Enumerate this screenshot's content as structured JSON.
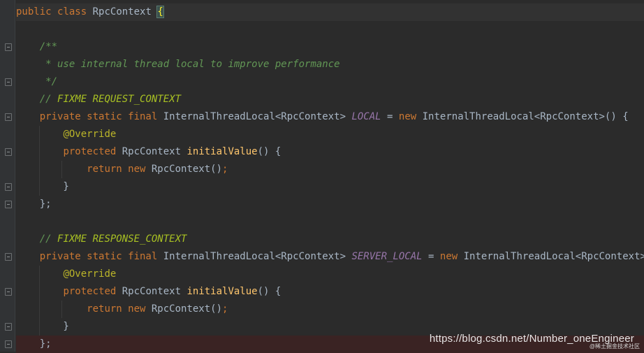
{
  "editor": {
    "theme": "Darcula",
    "colors": {
      "background": "#2b2b2b",
      "keyword": "#cc7832",
      "comment": "#629755",
      "todo": "#a8c023",
      "annotation": "#bbb529",
      "method": "#ffc66d",
      "field": "#9876aa",
      "text": "#a9b7c6"
    },
    "lines": [
      [
        {
          "k": "public"
        },
        {
          "p": " "
        },
        {
          "k": "class"
        },
        {
          "p": " RpcContext "
        },
        {
          "b": "{"
        }
      ],
      [],
      [
        {
          "p": "    "
        },
        {
          "c": "/**"
        }
      ],
      [
        {
          "p": "    "
        },
        {
          "c": " * use internal thread local to improve performance"
        }
      ],
      [
        {
          "p": "    "
        },
        {
          "c": " */"
        }
      ],
      [
        {
          "p": "    "
        },
        {
          "c": "// "
        },
        {
          "t": "FIXME REQUEST_CONTEXT"
        }
      ],
      [
        {
          "p": "    "
        },
        {
          "k": "private static final"
        },
        {
          "p": " InternalThreadLocal<RpcContext> "
        },
        {
          "f": "LOCAL"
        },
        {
          "p": " = "
        },
        {
          "k": "new"
        },
        {
          "p": " InternalThreadLocal<RpcContext>() {"
        }
      ],
      [
        {
          "p": "        "
        },
        {
          "a": "@Override"
        }
      ],
      [
        {
          "p": "        "
        },
        {
          "k": "protected"
        },
        {
          "p": " RpcContext "
        },
        {
          "m": "initialValue"
        },
        {
          "p": "() {"
        }
      ],
      [
        {
          "p": "            "
        },
        {
          "k": "return new"
        },
        {
          "p": " RpcContext()"
        },
        {
          "k": ";"
        }
      ],
      [
        {
          "p": "        }"
        }
      ],
      [
        {
          "p": "    };"
        }
      ],
      [],
      [
        {
          "p": "    "
        },
        {
          "c": "// "
        },
        {
          "t": "FIXME RESPONSE_CONTEXT"
        }
      ],
      [
        {
          "p": "    "
        },
        {
          "k": "private static final"
        },
        {
          "p": " InternalThreadLocal<RpcContext> "
        },
        {
          "f": "SERVER_LOCAL"
        },
        {
          "p": " = "
        },
        {
          "k": "new"
        },
        {
          "p": " InternalThreadLocal<RpcContext>() {"
        }
      ],
      [
        {
          "p": "        "
        },
        {
          "a": "@Override"
        }
      ],
      [
        {
          "p": "        "
        },
        {
          "k": "protected"
        },
        {
          "p": " RpcContext "
        },
        {
          "m": "initialValue"
        },
        {
          "p": "() {"
        }
      ],
      [
        {
          "p": "            "
        },
        {
          "k": "return new"
        },
        {
          "p": " RpcContext()"
        },
        {
          "k": ";"
        }
      ],
      [
        {
          "p": "        }"
        }
      ],
      [
        {
          "p": "    };"
        }
      ]
    ]
  },
  "watermark": {
    "url": "https://blog.csdn.net/Number_oneEngineer",
    "badge": "@稀土掘金技术社区"
  }
}
